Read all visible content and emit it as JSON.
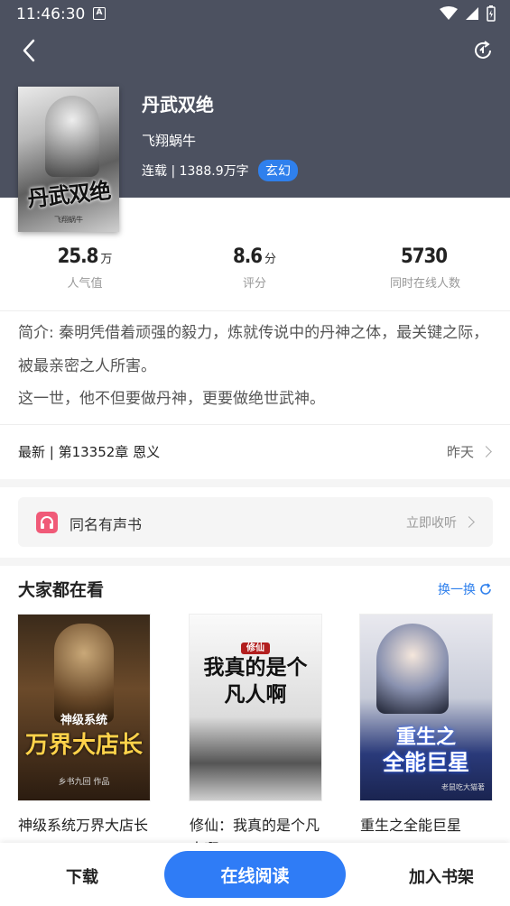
{
  "status_bar": {
    "time": "11:46:30",
    "badge": "A"
  },
  "header": {
    "back_icon": "back-arrow-icon",
    "refresh_icon": "refresh-icon"
  },
  "book": {
    "title": "丹武双绝",
    "author": "飞翔蜗牛",
    "meta": "连载 | 1388.9万字",
    "tag": "玄幻",
    "cover_title": "丹武双绝",
    "cover_author": "飞翔蜗牛"
  },
  "stats": [
    {
      "value": "25.8",
      "unit": "万",
      "label": "人气值"
    },
    {
      "value": "8.6",
      "unit": "分",
      "label": "评分"
    },
    {
      "value": "5730",
      "unit": "",
      "label": "同时在线人数"
    }
  ],
  "intro": {
    "line1": "简介: 秦明凭借着顽强的毅力，炼就传说中的丹神之体，最关键之际，被最亲密之人所害。",
    "line2": "这一世，他不但要做丹神，更要做绝世武神。"
  },
  "latest": {
    "text": "最新 | 第13352章 恩义",
    "time": "昨天"
  },
  "audio": {
    "label": "同名有声书",
    "action": "立即收听"
  },
  "recommend": {
    "title": "大家都在看",
    "swap_label": "换一换",
    "items": [
      {
        "name": "神级系统万界大店长",
        "cover_line1": "神级系统",
        "cover_line2": "万界大店长",
        "cover_author": "乡书九回 作品"
      },
      {
        "name": "修仙：我真的是个凡人啊",
        "cover_line1": "修仙",
        "cover_line2": "我真的是个凡人啊",
        "cover_author": ""
      },
      {
        "name": "重生之全能巨星",
        "cover_line1": "重生之",
        "cover_line2": "全能巨星",
        "cover_author": "老鼠吃大猫著"
      }
    ]
  },
  "bottom": {
    "download": "下载",
    "read": "在线阅读",
    "shelf": "加入书架"
  },
  "colors": {
    "header_bg": "#4c5160",
    "accent": "#2f7cf6",
    "audio_icon": "#f05a78"
  }
}
